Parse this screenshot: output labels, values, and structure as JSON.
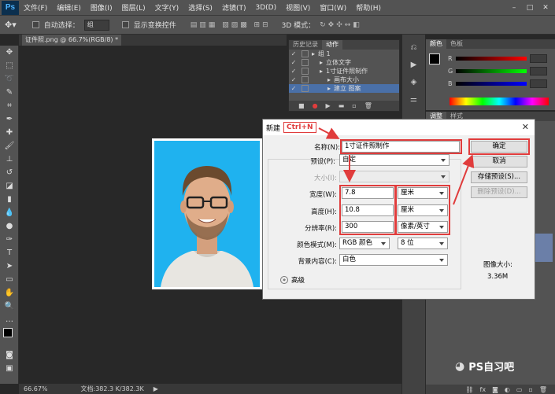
{
  "app": {
    "logo": "Ps",
    "menu": [
      "文件(F)",
      "编辑(E)",
      "图像(I)",
      "图层(L)",
      "文字(Y)",
      "选择(S)",
      "滤镜(T)",
      "3D(D)",
      "视图(V)",
      "窗口(W)",
      "帮助(H)"
    ],
    "window_buttons": [
      "–",
      "□",
      "✕"
    ]
  },
  "options_bar": {
    "auto_select_label": "自动选择：",
    "auto_select_value": "组",
    "show_transform_label": "显示变换控件",
    "mode_3d_label": "3D 模式："
  },
  "document": {
    "tab_title": "证件照.png @ 66.7%(RGB/8) *",
    "tab_close": "×"
  },
  "status_bar": {
    "zoom": "66.67%",
    "doc_info": "文档:382.3 K/382.3K"
  },
  "actions_panel": {
    "tabs": [
      "历史记录",
      "动作"
    ],
    "active_tab": 1,
    "rows": [
      {
        "check": "✓",
        "indent": 0,
        "label": "组 1",
        "highlight": false
      },
      {
        "check": "✓",
        "indent": 1,
        "label": "立体文字",
        "highlight": false
      },
      {
        "check": "✓",
        "indent": 1,
        "label": "1寸证件照制作",
        "highlight": false
      },
      {
        "check": "✓",
        "indent": 2,
        "label": "画布大小",
        "highlight": false
      },
      {
        "check": "✓",
        "indent": 2,
        "label": "建立 图案",
        "highlight": true
      }
    ]
  },
  "color_panel": {
    "tabs": [
      "颜色",
      "色板"
    ],
    "channels": [
      "R",
      "G",
      "B"
    ]
  },
  "adjust_panel": {
    "tabs": [
      "调整",
      "样式"
    ]
  },
  "dialog": {
    "title": "新建",
    "shortcut": "Ctrl+N",
    "close": "✕",
    "name_label": "名称(N):",
    "name_value": "1寸证件照制作",
    "preset_label": "预设(P):",
    "preset_value": "自定",
    "size_label": "大小(I):",
    "width_label": "宽度(W):",
    "width_value": "7.8",
    "width_unit": "厘米",
    "height_label": "高度(H):",
    "height_value": "10.8",
    "height_unit": "厘米",
    "resolution_label": "分辨率(R):",
    "resolution_value": "300",
    "resolution_unit": "像素/英寸",
    "color_mode_label": "颜色模式(M):",
    "color_mode_value": "RGB 颜色",
    "bit_depth_value": "8 位",
    "background_label": "背景内容(C):",
    "background_value": "白色",
    "advanced_label": "高级",
    "ok_button": "确定",
    "cancel_button": "取消",
    "save_preset_button": "存储预设(S)...",
    "delete_preset_button": "删除预设(D)...",
    "image_size_label": "图像大小:",
    "image_size_value": "3.36M"
  },
  "watermark": {
    "text": "PS自习吧"
  },
  "colors": {
    "accent_red": "#e03c3c",
    "photo_background": "#1fb2ef",
    "ui_dark": "#535353"
  }
}
